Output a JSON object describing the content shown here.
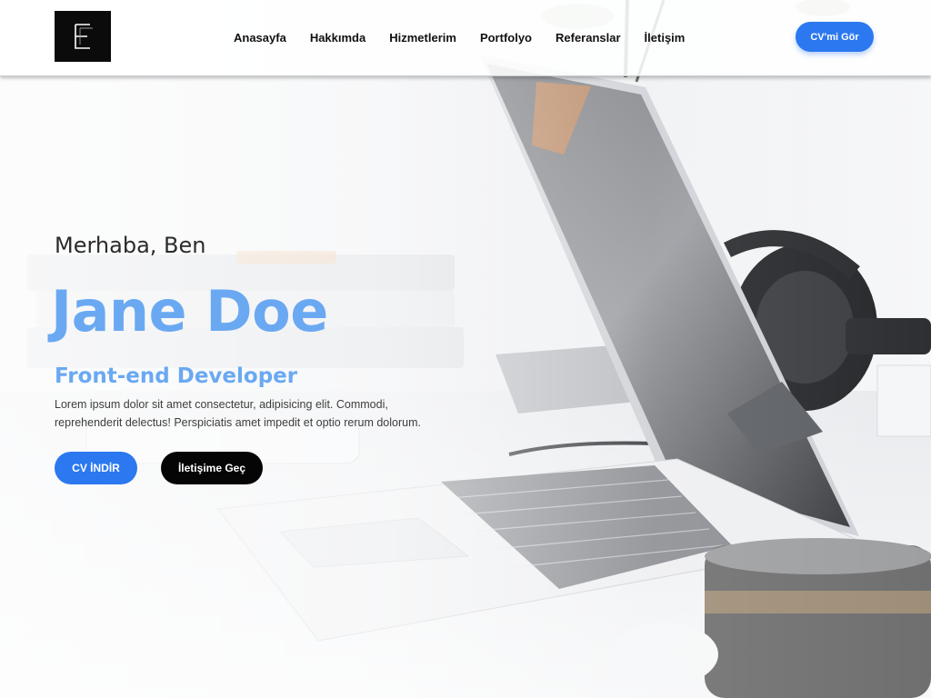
{
  "header": {
    "logo_letter": "E",
    "nav": [
      {
        "label": "Anasayfa"
      },
      {
        "label": "Hakkımda"
      },
      {
        "label": "Hizmetlerim"
      },
      {
        "label": "Portfolyo"
      },
      {
        "label": "Referanslar"
      },
      {
        "label": "İletişim"
      }
    ],
    "cv_button": "CV'mi Gör"
  },
  "hero": {
    "greeting": "Merhaba, Ben",
    "name": "Jane Doe",
    "role": "Front-end Developer",
    "bio": "Lorem ipsum dolor sit amet consectetur, adipisicing elit. Commodi, reprehenderit delectus! Perspiciatis amet impedit et optio rerum dolorum.",
    "download_button": "CV İNDİR",
    "contact_button": "İletişime Geç"
  },
  "colors": {
    "accent": "#2b78f0",
    "name_color": "#6aa9f2",
    "dark_button": "#050505"
  }
}
